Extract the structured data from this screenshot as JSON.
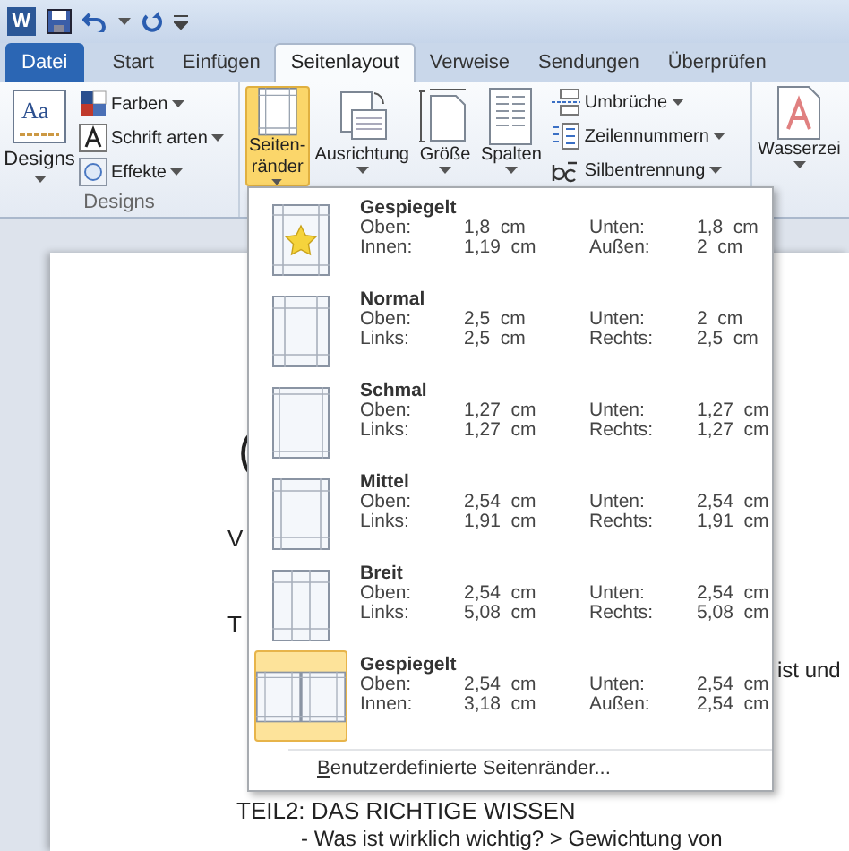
{
  "quick_access": {
    "app_logo": "W"
  },
  "tabs": [
    {
      "label": "Datei",
      "kind": "file",
      "selected": false
    },
    {
      "label": "Start",
      "kind": "tab",
      "selected": false
    },
    {
      "label": "Einfügen",
      "kind": "tab",
      "selected": false
    },
    {
      "label": "Seitenlayout",
      "kind": "tab",
      "selected": true
    },
    {
      "label": "Verweise",
      "kind": "tab",
      "selected": false
    },
    {
      "label": "Sendungen",
      "kind": "tab",
      "selected": false
    },
    {
      "label": "Überprüfen",
      "kind": "tab",
      "selected": false
    }
  ],
  "designs_group": {
    "label": "Designs",
    "big_button": {
      "label": "Designs",
      "icon_text": "Aa"
    },
    "small_buttons": [
      {
        "label": "Farben",
        "kind": "colors"
      },
      {
        "label": "Schrift arten",
        "kind": "fonts"
      },
      {
        "label": "Effekte",
        "kind": "effects"
      }
    ]
  },
  "page_setup_group": {
    "big_buttons": [
      {
        "lines": [
          "Seiten-",
          "ränder"
        ],
        "kind": "margins",
        "active": true
      },
      {
        "lines": [
          "Ausrichtung"
        ],
        "kind": "orientation",
        "active": false
      },
      {
        "lines": [
          "Größe"
        ],
        "kind": "size",
        "active": false
      },
      {
        "lines": [
          "Spalten"
        ],
        "kind": "columns",
        "active": false
      }
    ],
    "small_buttons": [
      {
        "label": "Umbrüche",
        "kind": "breaks"
      },
      {
        "label": "Zeilennummern",
        "kind": "linenumbers"
      },
      {
        "label": "Silbentrennung",
        "kind": "hyphenation"
      }
    ]
  },
  "background_group": {
    "big_button": {
      "label": "Wasserzei"
    }
  },
  "document": {
    "fragments": [
      "(",
      "V",
      "T"
    ],
    "right_fragment": "ist und",
    "heading": "TEIL2: DAS RICHTIGE WISSEN",
    "bullet": "- Was ist wirklich wichtig? > Gewichtung von"
  },
  "margins_menu": {
    "items": [
      {
        "name": "Gespiegelt",
        "kind": "custom",
        "selected": false,
        "rows": [
          [
            "Oben:",
            "1,8  cm",
            "Unten:",
            "1,8  cm"
          ],
          [
            "Innen:",
            "1,19  cm",
            "Außen:",
            "2  cm"
          ]
        ]
      },
      {
        "name": "Normal",
        "kind": "normal",
        "selected": false,
        "rows": [
          [
            "Oben:",
            "2,5  cm",
            "Unten:",
            "2  cm"
          ],
          [
            "Links:",
            "2,5  cm",
            "Rechts:",
            "2,5  cm"
          ]
        ]
      },
      {
        "name": "Schmal",
        "kind": "narrow",
        "selected": false,
        "rows": [
          [
            "Oben:",
            "1,27  cm",
            "Unten:",
            "1,27  cm"
          ],
          [
            "Links:",
            "1,27  cm",
            "Rechts:",
            "1,27  cm"
          ]
        ]
      },
      {
        "name": "Mittel",
        "kind": "moderate",
        "selected": false,
        "rows": [
          [
            "Oben:",
            "2,54  cm",
            "Unten:",
            "2,54  cm"
          ],
          [
            "Links:",
            "1,91  cm",
            "Rechts:",
            "1,91  cm"
          ]
        ]
      },
      {
        "name": "Breit",
        "kind": "wide",
        "selected": false,
        "rows": [
          [
            "Oben:",
            "2,54  cm",
            "Unten:",
            "2,54  cm"
          ],
          [
            "Links:",
            "5,08  cm",
            "Rechts:",
            "5,08  cm"
          ]
        ]
      },
      {
        "name": "Gespiegelt",
        "kind": "mirrored",
        "selected": true,
        "rows": [
          [
            "Oben:",
            "2,54  cm",
            "Unten:",
            "2,54  cm"
          ],
          [
            "Innen:",
            "3,18  cm",
            "Außen:",
            "2,54  cm"
          ]
        ]
      }
    ],
    "footer": {
      "access_key": "B",
      "rest": "enutzerdefinierte Seitenränder..."
    }
  }
}
